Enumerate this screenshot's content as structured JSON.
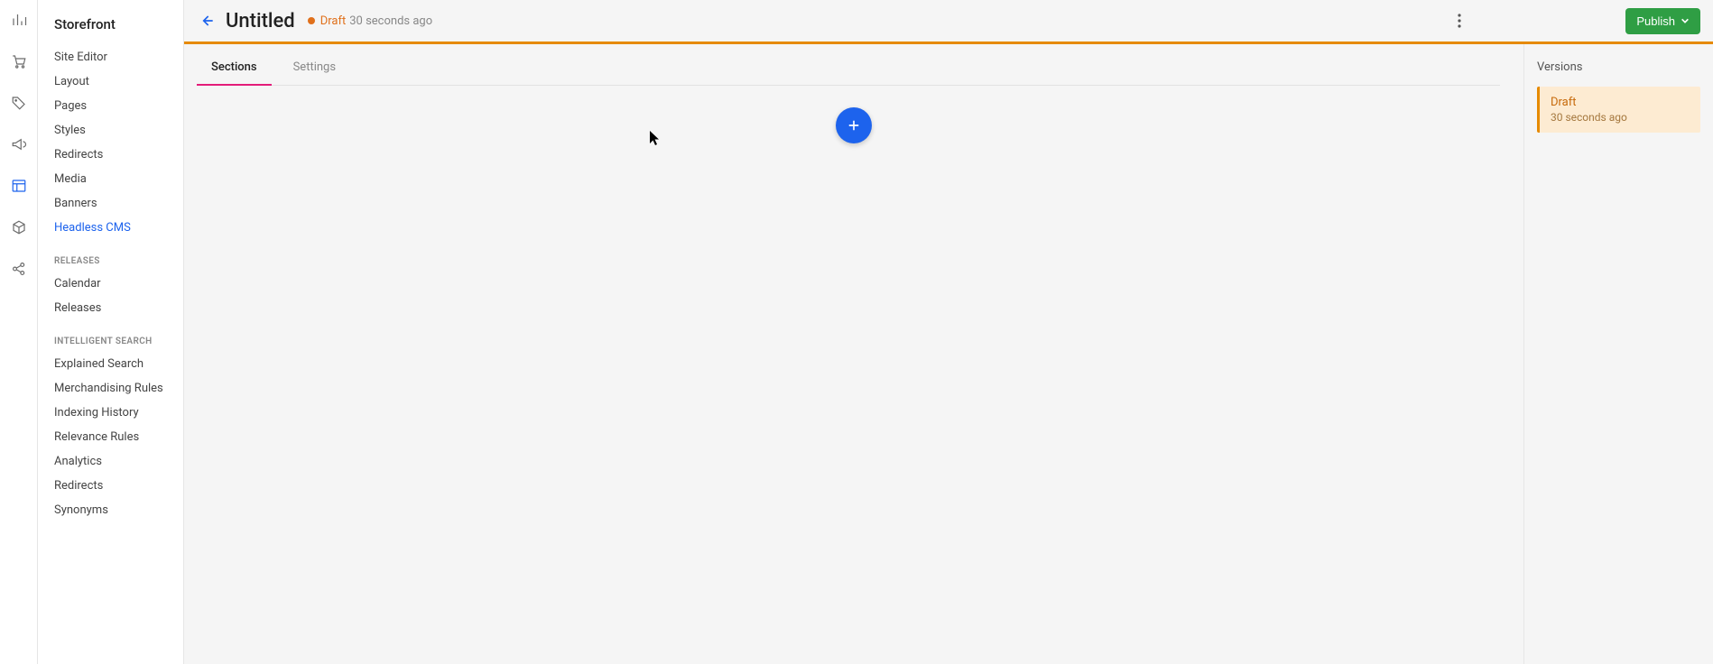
{
  "rail_icons": [
    "chart-icon",
    "cart-icon",
    "tag-icon",
    "megaphone-icon",
    "layout-icon",
    "cube-icon",
    "share-icon"
  ],
  "sidebar": {
    "title": "Storefront",
    "storefront_items": [
      {
        "label": "Site Editor"
      },
      {
        "label": "Layout"
      },
      {
        "label": "Pages"
      },
      {
        "label": "Styles"
      },
      {
        "label": "Redirects"
      },
      {
        "label": "Media"
      },
      {
        "label": "Banners"
      },
      {
        "label": "Headless CMS",
        "active": true
      }
    ],
    "releases_heading": "RELEASES",
    "releases_items": [
      {
        "label": "Calendar"
      },
      {
        "label": "Releases"
      }
    ],
    "search_heading": "INTELLIGENT SEARCH",
    "search_items": [
      {
        "label": "Explained Search"
      },
      {
        "label": "Merchandising Rules"
      },
      {
        "label": "Indexing History"
      },
      {
        "label": "Relevance Rules"
      },
      {
        "label": "Analytics"
      },
      {
        "label": "Redirects"
      },
      {
        "label": "Synonyms"
      }
    ]
  },
  "header": {
    "title": "Untitled",
    "status": "Draft",
    "timestamp": "30 seconds ago",
    "publish": "Publish"
  },
  "tabs": [
    {
      "label": "Sections",
      "active": true
    },
    {
      "label": "Settings"
    }
  ],
  "versions": {
    "title": "Versions",
    "items": [
      {
        "status": "Draft",
        "time": "30 seconds ago"
      }
    ]
  },
  "colors": {
    "accent_blue": "#1d63ed",
    "accent_orange": "#e68a00",
    "publish_green": "#2f9e44",
    "tab_underline": "#e31c79"
  }
}
